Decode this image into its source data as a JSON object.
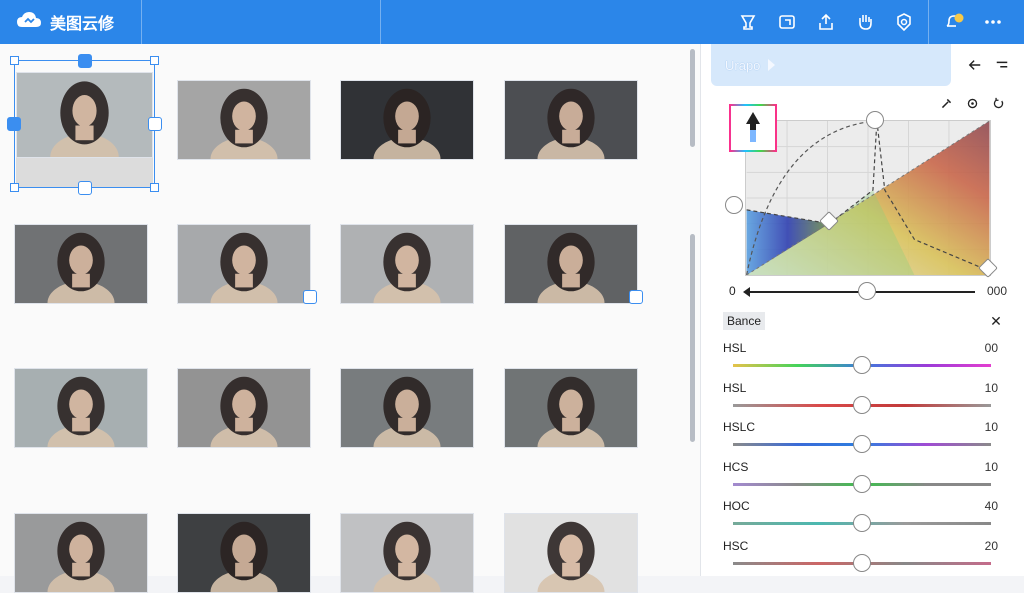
{
  "app": {
    "brand": "美图云修",
    "accent": "#2b86e9"
  },
  "toolbar": {
    "icons": [
      "cup-icon",
      "export-frame-icon",
      "share-upload-icon",
      "hand-icon",
      "settings-badge-icon",
      "notification-avatar-icon",
      "more-icon"
    ]
  },
  "grid": {
    "selected_index": 0,
    "thumbnails": [
      {
        "tone": "#9aa3a6",
        "bg": "#b8bec0"
      },
      {
        "tone": "#9a9a9a",
        "bg": "#a7a7a7"
      },
      {
        "tone": "#3a3a3a",
        "bg": "#2f3236"
      },
      {
        "tone": "#5b5e60",
        "bg": "#4a4d50"
      },
      {
        "tone": "#7d7d7d",
        "bg": "#6f7174"
      },
      {
        "tone": "#9c9c9c",
        "bg": "#a9abad"
      },
      {
        "tone": "#a4a6a8",
        "bg": "#b1b3b5"
      },
      {
        "tone": "#6b6b6b",
        "bg": "#5f6163"
      },
      {
        "tone": "#9ba3a5",
        "bg": "#a9b1b3"
      },
      {
        "tone": "#8a8a8a",
        "bg": "#949494"
      },
      {
        "tone": "#6c7072",
        "bg": "#7a7e80"
      },
      {
        "tone": "#7d8082",
        "bg": "#6f7274"
      },
      {
        "tone": "#8a8a8a",
        "bg": "#9b9c9e"
      },
      {
        "tone": "#444",
        "bg": "#3e4042"
      },
      {
        "tone": "#b2b2b2",
        "bg": "#c2c3c5"
      },
      {
        "tone": "#d8d8d8",
        "bg": "#e3e3e3"
      }
    ]
  },
  "panel": {
    "tab_label": "Urapo",
    "curve_left_value": "0",
    "curve_right_value": "000",
    "balance_label": "Bance",
    "sliders": [
      {
        "label": "HSL",
        "value": "00",
        "gradient": "linear-gradient(90deg,#e6c24a,#44d35a,#3c7bdc,#9b3bd8,#e33ed0)",
        "pos": 0.5
      },
      {
        "label": "HSL",
        "value": "10",
        "gradient": "linear-gradient(90deg,#999,#d94a4a,#c23a3a,#999)",
        "pos": 0.5
      },
      {
        "label": "HSLC",
        "value": "10",
        "gradient": "linear-gradient(90deg,#8a8a8a,#3a6bd8,#2d7ee0,#a04bd4,#8a8a8a)",
        "pos": 0.5
      },
      {
        "label": "HCS",
        "value": "10",
        "gradient": "linear-gradient(90deg,#a38ad0,#8a8a8a,#3dbf4d,#888,#888)",
        "pos": 0.5
      },
      {
        "label": "HOC",
        "value": "40",
        "gradient": "linear-gradient(90deg,#7a9,#4bb8b0,#9a9a9a,#888)",
        "pos": 0.5
      },
      {
        "label": "HSC",
        "value": "20",
        "gradient": "linear-gradient(90deg,#8a8a8a,#c66,#888,#c56b8a)",
        "pos": 0.5
      }
    ]
  }
}
